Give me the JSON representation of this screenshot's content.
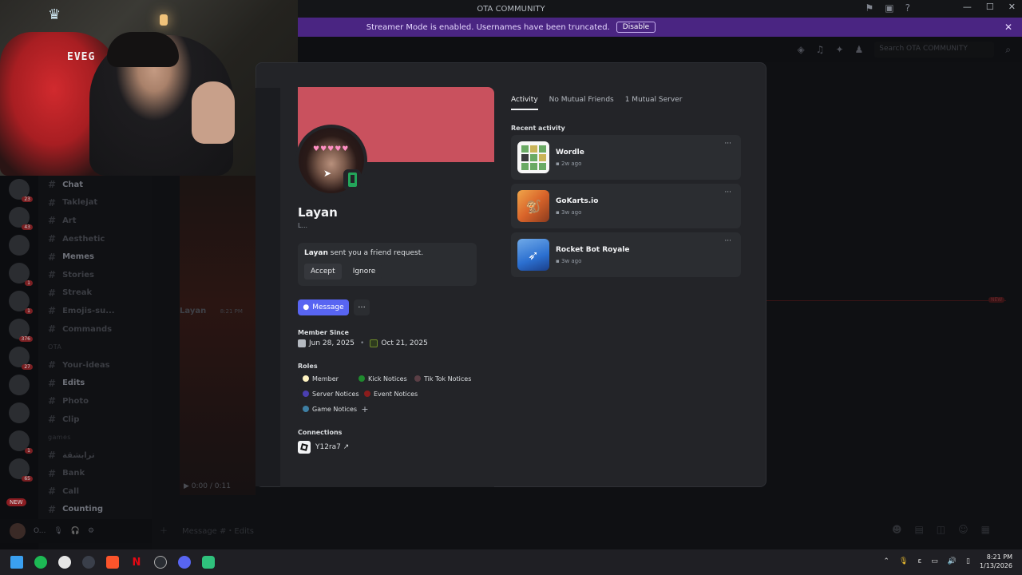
{
  "window": {
    "title": "OTA COMMUNITY"
  },
  "streamer_banner": {
    "text": "Streamer Mode is enabled. Usernames have been truncated.",
    "button": "Disable"
  },
  "search": {
    "placeholder": "Search OTA COMMUNITY"
  },
  "rail_badges": [
    "23",
    "43",
    "1",
    "1",
    "376",
    "27",
    "1",
    "1",
    "65"
  ],
  "rail_new": "NEW",
  "channels": [
    {
      "name": "Chat",
      "bright": true
    },
    {
      "name": "Taklejat",
      "bright": false
    },
    {
      "name": "Art",
      "bright": false
    },
    {
      "name": "Aesthetic",
      "bright": false
    },
    {
      "name": "Memes",
      "bright": true
    },
    {
      "name": "Stories",
      "bright": false
    },
    {
      "name": "Streak",
      "bright": false
    },
    {
      "name": "Emojis-su...",
      "bright": false
    },
    {
      "name": "Commands",
      "bright": false
    },
    {
      "name": "OTA",
      "bright": false,
      "category": true
    },
    {
      "name": "Your-ideas",
      "bright": false
    },
    {
      "name": "Edits",
      "bright": true
    },
    {
      "name": "Photo",
      "bright": false
    },
    {
      "name": "Clip",
      "bright": false
    },
    {
      "name": "games",
      "bright": false,
      "category": true
    },
    {
      "name": "ترابشقة",
      "bright": false
    },
    {
      "name": "Bank",
      "bright": false
    },
    {
      "name": "Call",
      "bright": false
    },
    {
      "name": "Counting",
      "bright": true
    }
  ],
  "user_panel": {
    "name": "O..."
  },
  "chat": {
    "author": "Layan",
    "time": "8:21 PM",
    "player_time": "0:00 / 0:11",
    "new_label": "NEW",
    "composer_placeholder": "Message #・Edits"
  },
  "profile": {
    "display_name": "Layan",
    "subtitle": "L...",
    "friend_request": {
      "name": "Layan",
      "text": "sent you a friend request.",
      "accept": "Accept",
      "ignore": "Ignore"
    },
    "message_button": "Message",
    "more_button": "···",
    "member_since_title": "Member Since",
    "discord_since": "Jun 28, 2025",
    "server_since": "Oct 21, 2025",
    "roles_title": "Roles",
    "roles": [
      {
        "name": "Member",
        "color": "#fff4c2"
      },
      {
        "name": "Kick Notices",
        "color": "#1f8a2e"
      },
      {
        "name": "Tik Tok Notices",
        "color": "#5a3e45"
      },
      {
        "name": "Server Notices",
        "color": "#4a3fb0"
      },
      {
        "name": "Event Notices",
        "color": "#8a1c1c"
      },
      {
        "name": "Game Notices",
        "color": "#3e7fa3"
      }
    ],
    "role_add": "+",
    "connections_title": "Connections",
    "connection": "Y12ra7 ↗"
  },
  "panel": {
    "tabs": [
      "Activity",
      "No Mutual Friends",
      "1 Mutual Server"
    ],
    "recent_title": "Recent activity",
    "activities": [
      {
        "name": "Wordle",
        "time": "2w ago"
      },
      {
        "name": "GoKarts.io",
        "time": "3w ago"
      },
      {
        "name": "Rocket Bot Royale",
        "time": "3w ago"
      }
    ]
  },
  "taskbar": {
    "time": "8:21 PM",
    "date": "1/13/2026",
    "lang": "ε"
  },
  "colors": {
    "banner": "#c9515e",
    "accent": "#5865f2",
    "online": "#23a55a",
    "streamer_bar": "#4a2582"
  }
}
